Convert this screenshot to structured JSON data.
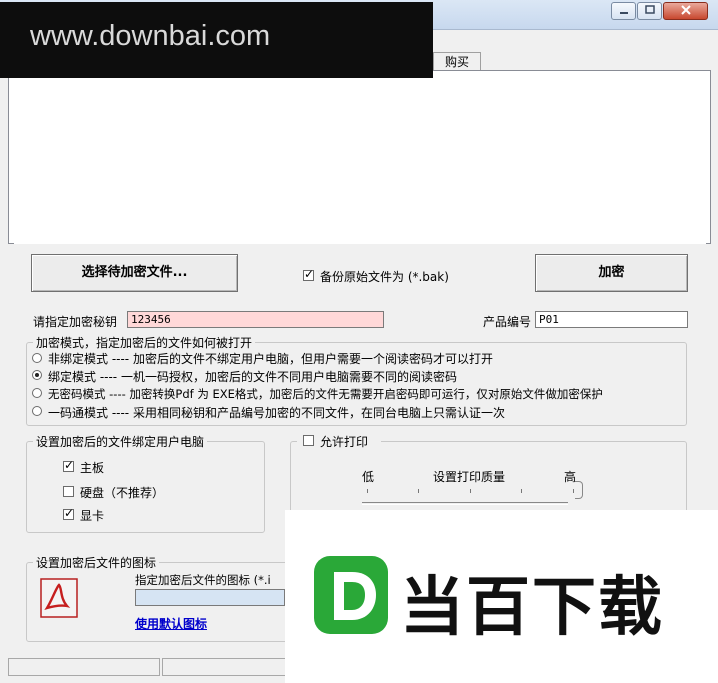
{
  "watermark_top": "www.downbai.com",
  "watermark_brand": "当百下载",
  "tabs": [
    "购买"
  ],
  "select_button": "选择待加密文件...",
  "backup": {
    "label": "备份原始文件为 (*.bak)",
    "checked": true
  },
  "encrypt_button": "加密",
  "key_label": "请指定加密秘钥",
  "key_value": "123456",
  "product_label": "产品编号",
  "product_value": "P01",
  "mode_group": {
    "title": "加密模式，指定加密后的文件如何被打开",
    "options": [
      {
        "label": "非绑定模式 ---- 加密后的文件不绑定用户电脑，但用户需要一个阅读密码才可以打开",
        "checked": false
      },
      {
        "label": "绑定模式 ---- 一机一码授权，加密后的文件不同用户电脑需要不同的阅读密码",
        "checked": true
      },
      {
        "label": "无密码模式 ---- 加密转换Pdf 为 EXE格式，加密后的文件无需要开启密码即可运行，仅对原始文件做加密保护",
        "checked": false
      },
      {
        "label": "一码通模式 ---- 采用相同秘钥和产品编号加密的不同文件，在同台电脑上只需认证一次",
        "checked": false
      }
    ]
  },
  "bind_group": {
    "title": "设置加密后的文件绑定用户电脑",
    "options": [
      {
        "label": "主板",
        "checked": true
      },
      {
        "label": "硬盘（不推荐）",
        "checked": false
      },
      {
        "label": "显卡",
        "checked": true
      }
    ]
  },
  "print_group": {
    "allow_label": "允许打印",
    "allow_checked": false,
    "quality_title": "设置打印质量",
    "low": "低",
    "high": "高"
  },
  "icon_group": {
    "title": "设置加密后文件的图标",
    "field_label": "指定加密后文件的图标 (*.i",
    "default_link": "使用默认图标"
  },
  "colors": {
    "key_field_bg": "#ffd8d8",
    "brand_green": "#2aa838",
    "link": "#0000cc"
  }
}
